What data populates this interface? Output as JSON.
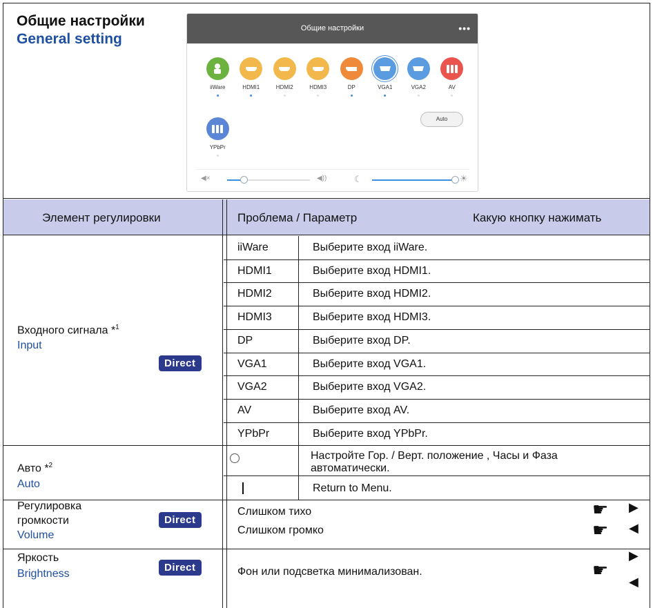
{
  "header": {
    "title_ru": "Общие настройки",
    "title_en": "General setting"
  },
  "panel": {
    "title": "Общие настройки",
    "menu_icon": "more-dots-icon",
    "sources": [
      {
        "label": "iiWare",
        "icon": "android-icon",
        "color": "#6bb33e",
        "dot": true
      },
      {
        "label": "HDMI1",
        "icon": "hdmi-icon",
        "color": "#f2b84b",
        "dot": true
      },
      {
        "label": "HDMI2",
        "icon": "hdmi-icon",
        "color": "#f2b84b",
        "dot": false
      },
      {
        "label": "HDMI3",
        "icon": "hdmi-icon",
        "color": "#f2b84b",
        "dot": false
      },
      {
        "label": "DP",
        "icon": "dp-icon",
        "color": "#f08a3b",
        "dot": true
      },
      {
        "label": "VGA1",
        "icon": "vga-icon",
        "color": "#5b9be0",
        "dot": true,
        "selected": true
      },
      {
        "label": "VGA2",
        "icon": "vga-icon",
        "color": "#5b9be0",
        "dot": false
      },
      {
        "label": "AV",
        "icon": "av-icon",
        "color": "#e9544d",
        "dot": false
      }
    ],
    "ypbpr": {
      "label": "YPbPr",
      "icon": "component-icon",
      "color": "#5b86d6"
    },
    "auto_label": "Auto",
    "volume_level": 0.2,
    "brightness_level": 1.0,
    "accent": "#3c8ee0"
  },
  "table": {
    "head": {
      "col1": "Элемент регулировки",
      "col2": "Проблема / Параметр",
      "col3": "Какую кнопку нажимать"
    },
    "input": {
      "label_ru": "Входного сигнала *",
      "note": "1",
      "label_en": "Input",
      "direct": "Direct",
      "rows": [
        {
          "key": "iiWare",
          "desc": "Выберите вход iiWare."
        },
        {
          "key": "HDMI1",
          "desc": "Выберите вход HDMI1."
        },
        {
          "key": "HDMI2",
          "desc": "Выберите вход HDMI2."
        },
        {
          "key": "HDMI3",
          "desc": "Выберите вход HDMI3."
        },
        {
          "key": "DP",
          "desc": "Выберите вход DP."
        },
        {
          "key": "VGA1",
          "desc": "Выберите вход VGA1."
        },
        {
          "key": "VGA2",
          "desc": "Выберите вход VGA2."
        },
        {
          "key": "AV",
          "desc": "Выберите вход AV."
        },
        {
          "key": "YPbPr",
          "desc": "Выберите вход YPbPr."
        }
      ]
    },
    "auto": {
      "label_ru": "Авто *",
      "note": "2",
      "label_en": "Auto",
      "row1_desc_line1": "Настройте Гор. / Верт. положение , Часы и Фаза",
      "row1_desc_line2": "автоматически.",
      "row2_desc": "Return to Menu."
    },
    "volume": {
      "label_ru_line1": "Регулировка",
      "label_ru_line2": "громкости",
      "label_en": "Volume",
      "direct": "Direct",
      "low": "Слишком тихо",
      "high": "Слишком громко"
    },
    "brightness": {
      "label_ru": "Яркость",
      "label_en": "Brightness",
      "direct": "Direct",
      "desc": "Фон или подсветка минимализован."
    }
  }
}
